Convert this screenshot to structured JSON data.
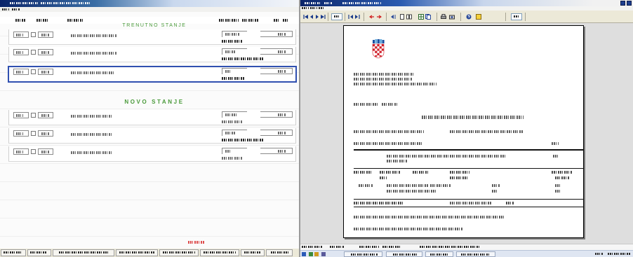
{
  "left_window": {
    "section_current_label": "TRENUTNO STANJE",
    "section_new_label": "NOVO STANJE",
    "selected_row": 3
  },
  "right_window": {
    "toolbar_icons": [
      "first-page-icon",
      "previous-page-icon",
      "next-page-icon",
      "last-page-icon",
      "previous-record-icon",
      "next-record-icon",
      "red-arrow-left-icon",
      "red-arrow-right-icon",
      "page-back-icon",
      "single-page-icon",
      "two-page-icon",
      "grid-icon",
      "multi-page-icon",
      "printer-icon",
      "print-setup-icon",
      "help-icon",
      "note-icon"
    ],
    "document_emblem": "croatian-coat-of-arms-icon"
  },
  "colors": {
    "title_bar": "#0a246a",
    "section_label": "#4a9a3a",
    "selection_border": "#3050b0",
    "footer_notice": "#d83030",
    "emblem_red": "#d0202a"
  }
}
